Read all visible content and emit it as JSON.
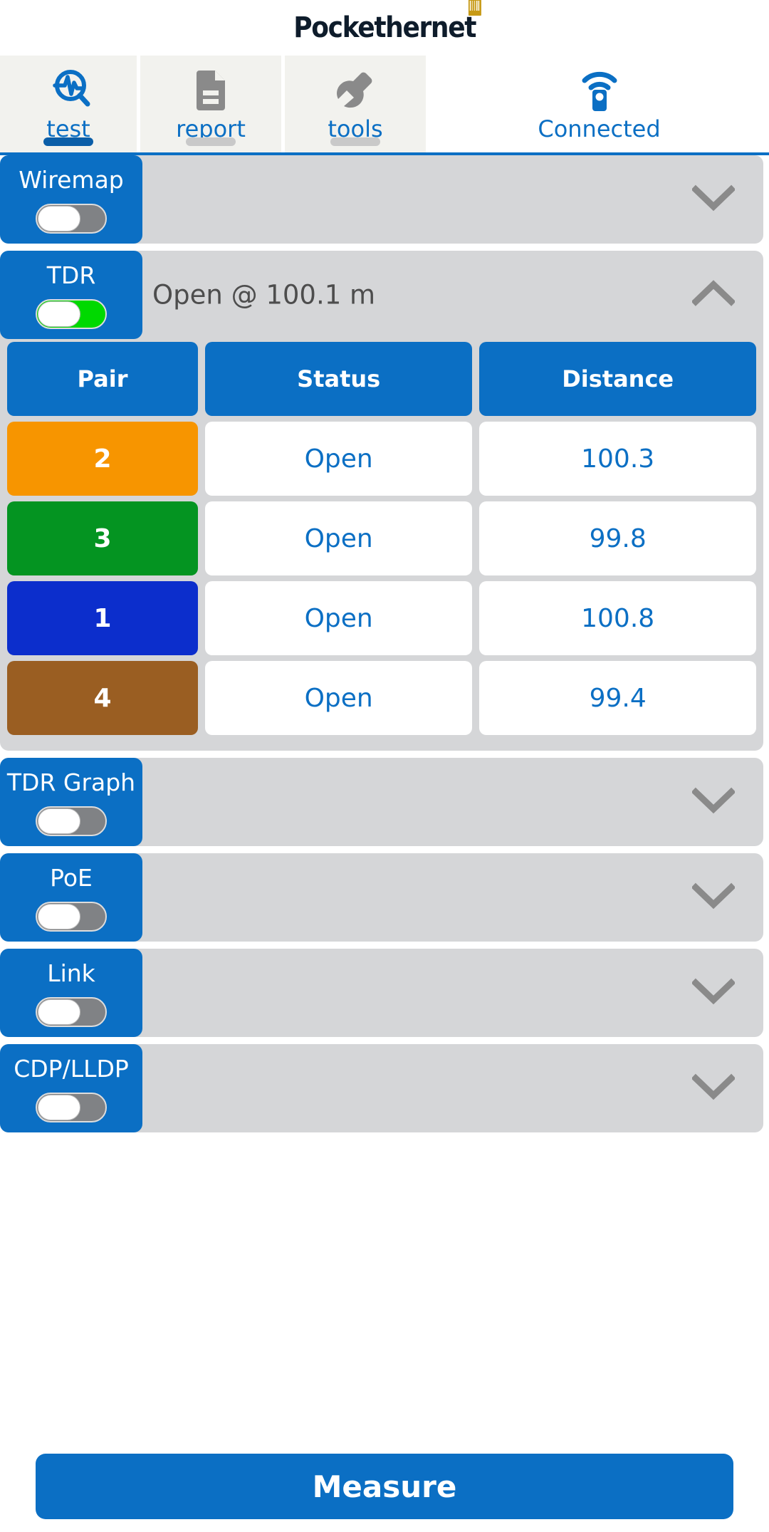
{
  "brand": {
    "name": "Pockethernet"
  },
  "tabs": [
    {
      "label": "test",
      "icon": "pulse-search-icon",
      "active": true,
      "color": "#0b6fc4"
    },
    {
      "label": "report",
      "icon": "document-icon",
      "active": false,
      "color": "#8a8a8a"
    },
    {
      "label": "tools",
      "icon": "wrench-icon",
      "active": false,
      "color": "#8a8a8a"
    },
    {
      "label": "Connected",
      "icon": "device-wifi-icon",
      "active": false,
      "color": "#0b6fc4"
    }
  ],
  "sections": [
    {
      "title": "Wiremap",
      "toggle": "off",
      "status": "",
      "chevron": "chevron-down"
    },
    {
      "title": "TDR",
      "toggle": "on",
      "status": "Open @ 100.1 m",
      "chevron": "chevron-up"
    },
    {
      "title": "TDR Graph",
      "toggle": "off",
      "status": "",
      "chevron": "chevron-down"
    },
    {
      "title": "PoE",
      "toggle": "off",
      "status": "",
      "chevron": "chevron-down"
    },
    {
      "title": "Link",
      "toggle": "off",
      "status": "",
      "chevron": "chevron-down"
    },
    {
      "title": "CDP/LLDP",
      "toggle": "off",
      "status": "",
      "chevron": "chevron-down"
    }
  ],
  "tdr_table": {
    "headers": [
      "Pair",
      "Status",
      "Distance"
    ],
    "rows": [
      {
        "pair": "2",
        "color": "#f79500",
        "status": "Open",
        "distance": "100.3"
      },
      {
        "pair": "3",
        "color": "#049421",
        "status": "Open",
        "distance": "99.8"
      },
      {
        "pair": "1",
        "color": "#0c2ecc",
        "status": "Open",
        "distance": "100.8"
      },
      {
        "pair": "4",
        "color": "#9a5e22",
        "status": "Open",
        "distance": "99.4"
      }
    ]
  },
  "footer": {
    "measure_label": "Measure"
  },
  "colors": {
    "accent": "#0b6fc4",
    "section_bg": "#d5d6d8",
    "tab_bg": "#f2f2ee",
    "toggle_on": "#00d900",
    "toggle_off": "#808285",
    "status_text": "#4d4d4d"
  }
}
